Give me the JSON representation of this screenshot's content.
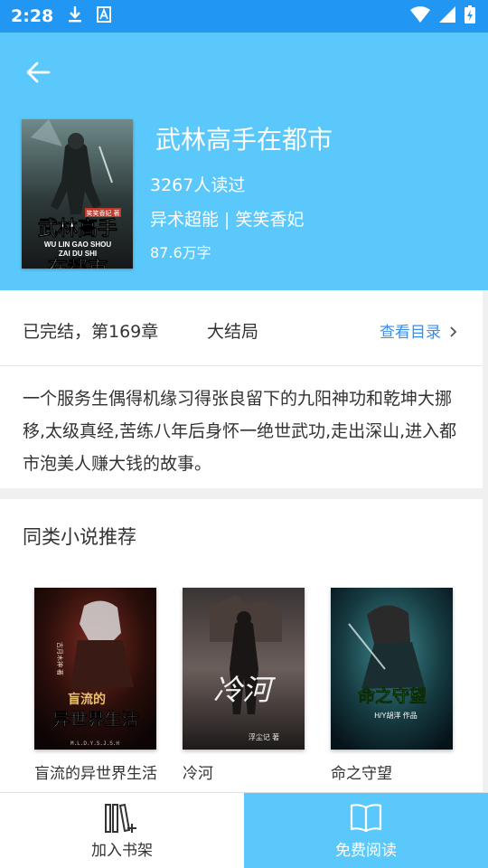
{
  "status_bar": {
    "time": "2:28",
    "icons": [
      "download-icon",
      "font-icon",
      "wifi-icon",
      "signal-icon",
      "battery-icon"
    ]
  },
  "colors": {
    "header_bg": "#5ac8fa",
    "status_bg": "#2196f3",
    "link": "#3a8ee6"
  },
  "book": {
    "title": "武林高手在都市",
    "readers": "3267人读过",
    "genre_author": "异术超能 | 笑笑香妃",
    "word_count": "87.6万字",
    "cover": {
      "title_lines": [
        "武林高手",
        "在都市"
      ],
      "pinyin_lines": [
        "WU LIN GAO SHOU",
        "ZAI DU SHI"
      ],
      "author_tag": "笑笑香妃 著"
    }
  },
  "chapter": {
    "status": "已完结，第169章",
    "last_chapter": "大结局",
    "toc_label": "查看目录"
  },
  "description": "一个服务生偶得机缘习得张良留下的九阳神功和乾坤大挪移,太级真经,苦练八年后身怀一绝世武功,走出深山,进入都市泡美人赚大钱的故事。",
  "recommend": {
    "heading": "同类小说推荐",
    "items": [
      {
        "name": "盲流的异世界生活",
        "cover_lines": [
          "盲流的",
          "异世界生活"
        ],
        "cover_small": "古月木神 著",
        "cover_footer": "M.L.D.Y.S.J.S.H"
      },
      {
        "name": "冷河",
        "cover_lines": [
          "冷河"
        ],
        "cover_small": "浮尘记 著"
      },
      {
        "name": "命之守望",
        "cover_lines": [
          "命之守望"
        ],
        "cover_small": "H/Y胡洋 作品"
      }
    ]
  },
  "bottom_bar": {
    "shelf_label": "加入书架",
    "read_label": "免费阅读"
  }
}
